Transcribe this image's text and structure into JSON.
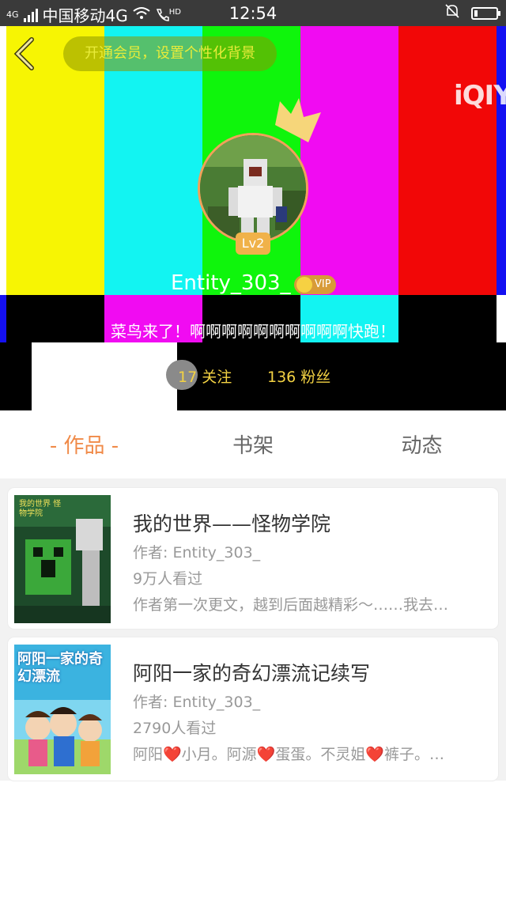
{
  "status_bar": {
    "network_label": "4G",
    "carrier": "中国移动4G",
    "hd_label": "HD",
    "time": "12:54",
    "battery_level": 0.15
  },
  "header": {
    "vip_prompt": "开通会员，设置个性化背景",
    "watermark": "iQIYI",
    "level": "Lv2",
    "username": "Entity_303_",
    "vip_label": "VIP",
    "signature": "菜鸟来了！啊啊啊啊啊啊啊啊啊啊快跑！",
    "following": "17 关注",
    "fans": "136 粉丝"
  },
  "tabs": [
    {
      "label": "- 作品 -",
      "active": true
    },
    {
      "label": "书架",
      "active": false
    },
    {
      "label": "动态",
      "active": false
    }
  ],
  "works": [
    {
      "title": "我的世界——怪物学院",
      "author": "作者: Entity_303_",
      "views": "9万人看过",
      "description": "作者第一次更文，越到后面越精彩～……我去…",
      "cover_text": "我的世界 怪物学院"
    },
    {
      "title": "阿阳一家的奇幻漂流记续写",
      "author": "作者: Entity_303_",
      "views": "2790人看过",
      "description": "阿阳❤️小月。阿源❤️蛋蛋。不灵姐❤️裤子。…",
      "cover_text": "阿阳一家的奇幻漂流"
    }
  ],
  "colors": {
    "accent": "#f08a48",
    "status_bar": "#3a3a3a",
    "fans_text": "#f3d243"
  }
}
